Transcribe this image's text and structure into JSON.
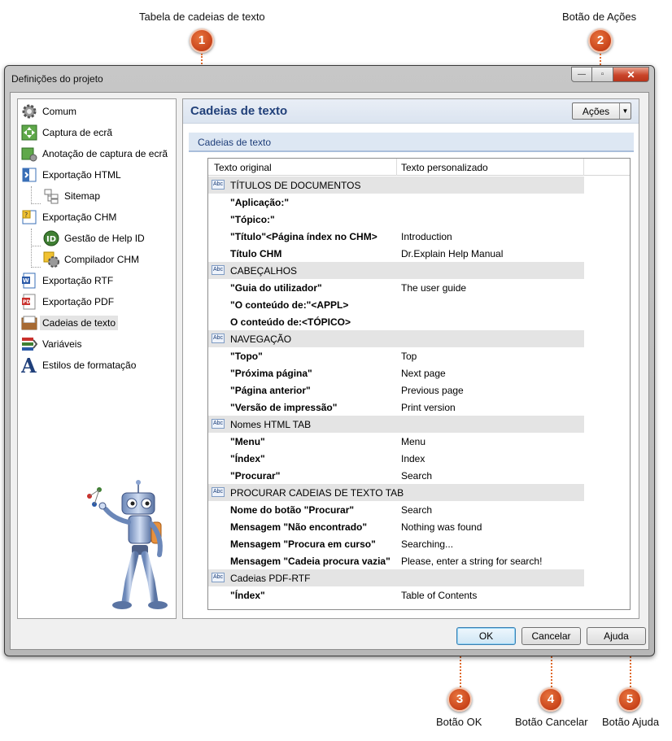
{
  "callouts": [
    {
      "num": "1",
      "label": "Tabela de cadeias de texto"
    },
    {
      "num": "2",
      "label": "Botão de Ações"
    },
    {
      "num": "3",
      "label": "Botão OK"
    },
    {
      "num": "4",
      "label": "Botão Cancelar"
    },
    {
      "num": "5",
      "label": "Botão Ajuda"
    }
  ],
  "window": {
    "title": "Definições do projeto",
    "min_glyph": "—",
    "max_glyph": "▫",
    "close_glyph": "✕"
  },
  "sidebar": {
    "items": [
      {
        "label": "Comum",
        "icon": "gear-icon"
      },
      {
        "label": "Captura de ecrã",
        "icon": "capture-icon"
      },
      {
        "label": "Anotação de captura de ecrã",
        "icon": "annotation-icon"
      },
      {
        "label": "Exportação HTML",
        "icon": "html-export-icon"
      },
      {
        "label": "Sitemap",
        "icon": "sitemap-icon"
      },
      {
        "label": "Exportação CHM",
        "icon": "chm-export-icon"
      },
      {
        "label": "Gestão de Help ID",
        "icon": "help-id-icon"
      },
      {
        "label": "Compilador CHM",
        "icon": "compiler-icon"
      },
      {
        "label": "Exportação RTF",
        "icon": "rtf-export-icon"
      },
      {
        "label": "Exportação PDF",
        "icon": "pdf-export-icon"
      },
      {
        "label": "Cadeias de texto",
        "icon": "text-strings-icon"
      },
      {
        "label": "Variáveis",
        "icon": "variables-icon"
      },
      {
        "label": "Estilos de formatação",
        "icon": "formatting-styles-icon"
      }
    ],
    "selected_index": 10
  },
  "panel": {
    "title": "Cadeias de texto",
    "actions_label": "Ações",
    "section_label": "Cadeias de texto"
  },
  "table": {
    "headers": [
      "Texto original",
      "Texto personalizado"
    ],
    "rows": [
      {
        "type": "group",
        "original": "TÍTULOS DE DOCUMENTOS",
        "custom": ""
      },
      {
        "type": "item",
        "original": "\"Aplicação:\"",
        "custom": ""
      },
      {
        "type": "item",
        "original": "\"Tópico:\"",
        "custom": ""
      },
      {
        "type": "item",
        "original": "\"Título\"<Página índex no CHM>",
        "custom": "Introduction"
      },
      {
        "type": "item",
        "original": "Título CHM",
        "custom": "Dr.Explain Help Manual"
      },
      {
        "type": "group",
        "original": "CABEÇALHOS",
        "custom": ""
      },
      {
        "type": "item",
        "original": "\"Guia do utilizador\"",
        "custom": "The user guide"
      },
      {
        "type": "item",
        "original": "\"O conteúdo de:\"<APPL>",
        "custom": ""
      },
      {
        "type": "item",
        "original": "O conteúdo de:<TÓPICO>",
        "custom": ""
      },
      {
        "type": "group",
        "original": "NAVEGAÇÃO",
        "custom": ""
      },
      {
        "type": "item",
        "original": "\"Topo\"",
        "custom": "Top"
      },
      {
        "type": "item",
        "original": "\"Próxima página\"",
        "custom": "Next page"
      },
      {
        "type": "item",
        "original": "\"Página anterior\"",
        "custom": "Previous page"
      },
      {
        "type": "item",
        "original": "\"Versão de impressão\"",
        "custom": "Print version"
      },
      {
        "type": "group",
        "original": "Nomes HTML TAB",
        "custom": ""
      },
      {
        "type": "item",
        "original": "\"Menu\"",
        "custom": "Menu"
      },
      {
        "type": "item",
        "original": "\"Índex\"",
        "custom": "Index"
      },
      {
        "type": "item",
        "original": "\"Procurar\"",
        "custom": "Search"
      },
      {
        "type": "group",
        "original": "PROCURAR CADEIAS DE TEXTO TAB",
        "custom": ""
      },
      {
        "type": "item",
        "original": "Nome do botão \"Procurar\"",
        "custom": "Search"
      },
      {
        "type": "item",
        "original": "Mensagem \"Não encontrado\"",
        "custom": "Nothing was found"
      },
      {
        "type": "item",
        "original": "Mensagem \"Procura em curso\"",
        "custom": "Searching..."
      },
      {
        "type": "item",
        "original": "Mensagem \"Cadeia procura vazia\"",
        "custom": "Please, enter a string for search!"
      },
      {
        "type": "group",
        "original": "Cadeias PDF-RTF",
        "custom": ""
      },
      {
        "type": "item",
        "original": "\"Índex\"",
        "custom": "Table of Contents"
      }
    ]
  },
  "buttons": {
    "ok": "OK",
    "cancel": "Cancelar",
    "help": "Ajuda"
  },
  "colors": {
    "accent": "#e06a2c",
    "header_title": "#22417a",
    "group_row": "#e4e4e4"
  }
}
